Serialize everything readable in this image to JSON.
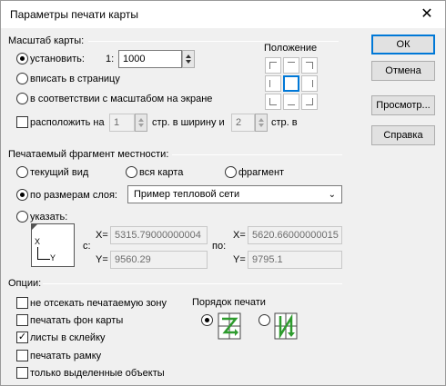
{
  "window": {
    "title": "Параметры печати карты",
    "close_label": "✕"
  },
  "scale": {
    "label": "Масштаб карты:",
    "set_label": "установить:",
    "ratio_prefix": "1:",
    "ratio_value": "1000",
    "fit_label": "вписать в страницу",
    "screen_label": "в соответствии с масштабом на экране",
    "place_label": "расположить на",
    "width_value": "1",
    "width_label": "стр. в ширину и",
    "height_value": "2",
    "height_label": "стр. в"
  },
  "position": {
    "label": "Положение"
  },
  "fragment": {
    "label": "Печатаемый фрагмент местности:",
    "current_label": "текущий вид",
    "whole_label": "вся карта",
    "fragment_label": "фрагмент",
    "layer_label": "по размерам слоя:",
    "layer_value": "Пример тепловой сети",
    "specify_label": "указать:",
    "from_label": "с:",
    "to_label": "по:",
    "x_label": "X=",
    "y_label": "Y=",
    "x_from": "5315.79000000004",
    "y_from": "9560.29",
    "x_to": "5620.66000000015",
    "y_to": "9795.1",
    "axis_x": "X",
    "axis_y": "Y"
  },
  "options": {
    "label": "Опции:",
    "no_cut_label": "не отсекать печатаемую зону",
    "bg_label": "печатать фон карты",
    "glue_label": "листы в склейку",
    "frame_label": "печатать рамку",
    "selected_label": "только выделенные объекты",
    "check_mark": "✓"
  },
  "print_order": {
    "label": "Порядок печати"
  },
  "buttons": {
    "ok": "ОК",
    "cancel": "Отмена",
    "preview": "Просмотр...",
    "help": "Справка"
  },
  "colors": {
    "accent": "#0078d7",
    "order_green": "#2e9b2e"
  }
}
